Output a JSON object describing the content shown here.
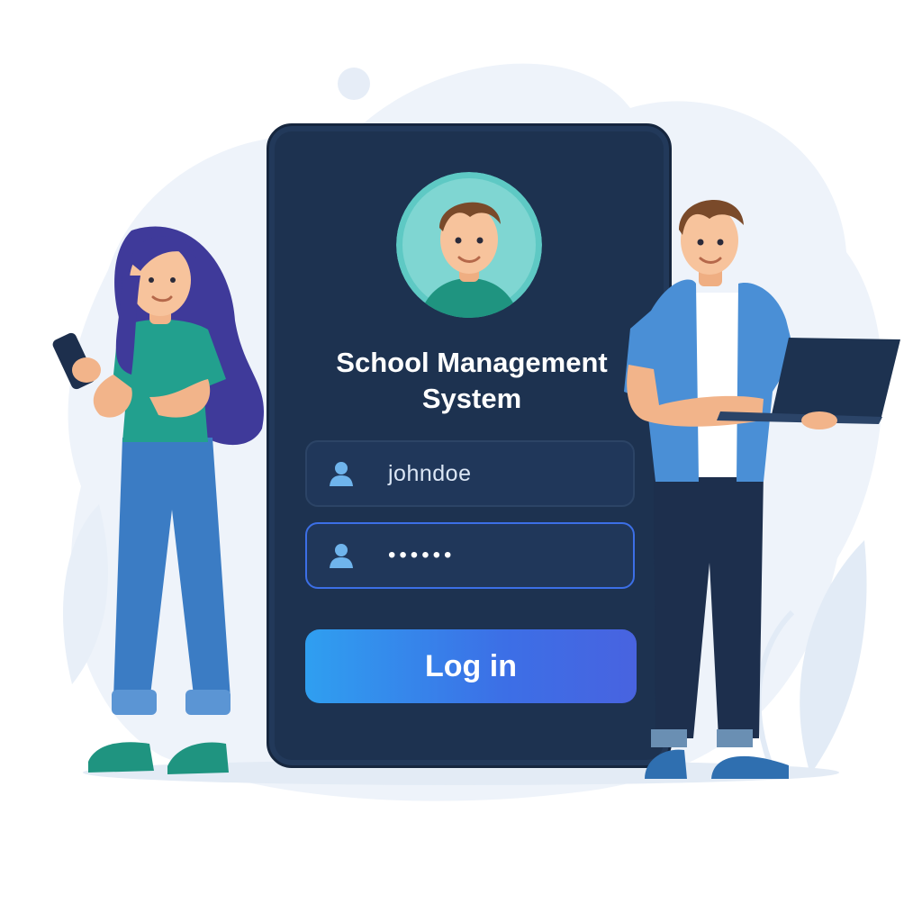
{
  "login": {
    "app_title": "School Management System",
    "username_value": "johndoe",
    "password_mask": "••••••",
    "login_button_label": "Log in"
  },
  "icons": {
    "avatar": "user-avatar-icon",
    "username": "user-icon",
    "password": "user-icon"
  },
  "colors": {
    "card_background": "#1d3250",
    "accent_blue": "#3c6fe6",
    "button_gradient_start": "#2f9ff0",
    "button_gradient_end": "#4863e0",
    "avatar_background": "#5ec9c4"
  }
}
